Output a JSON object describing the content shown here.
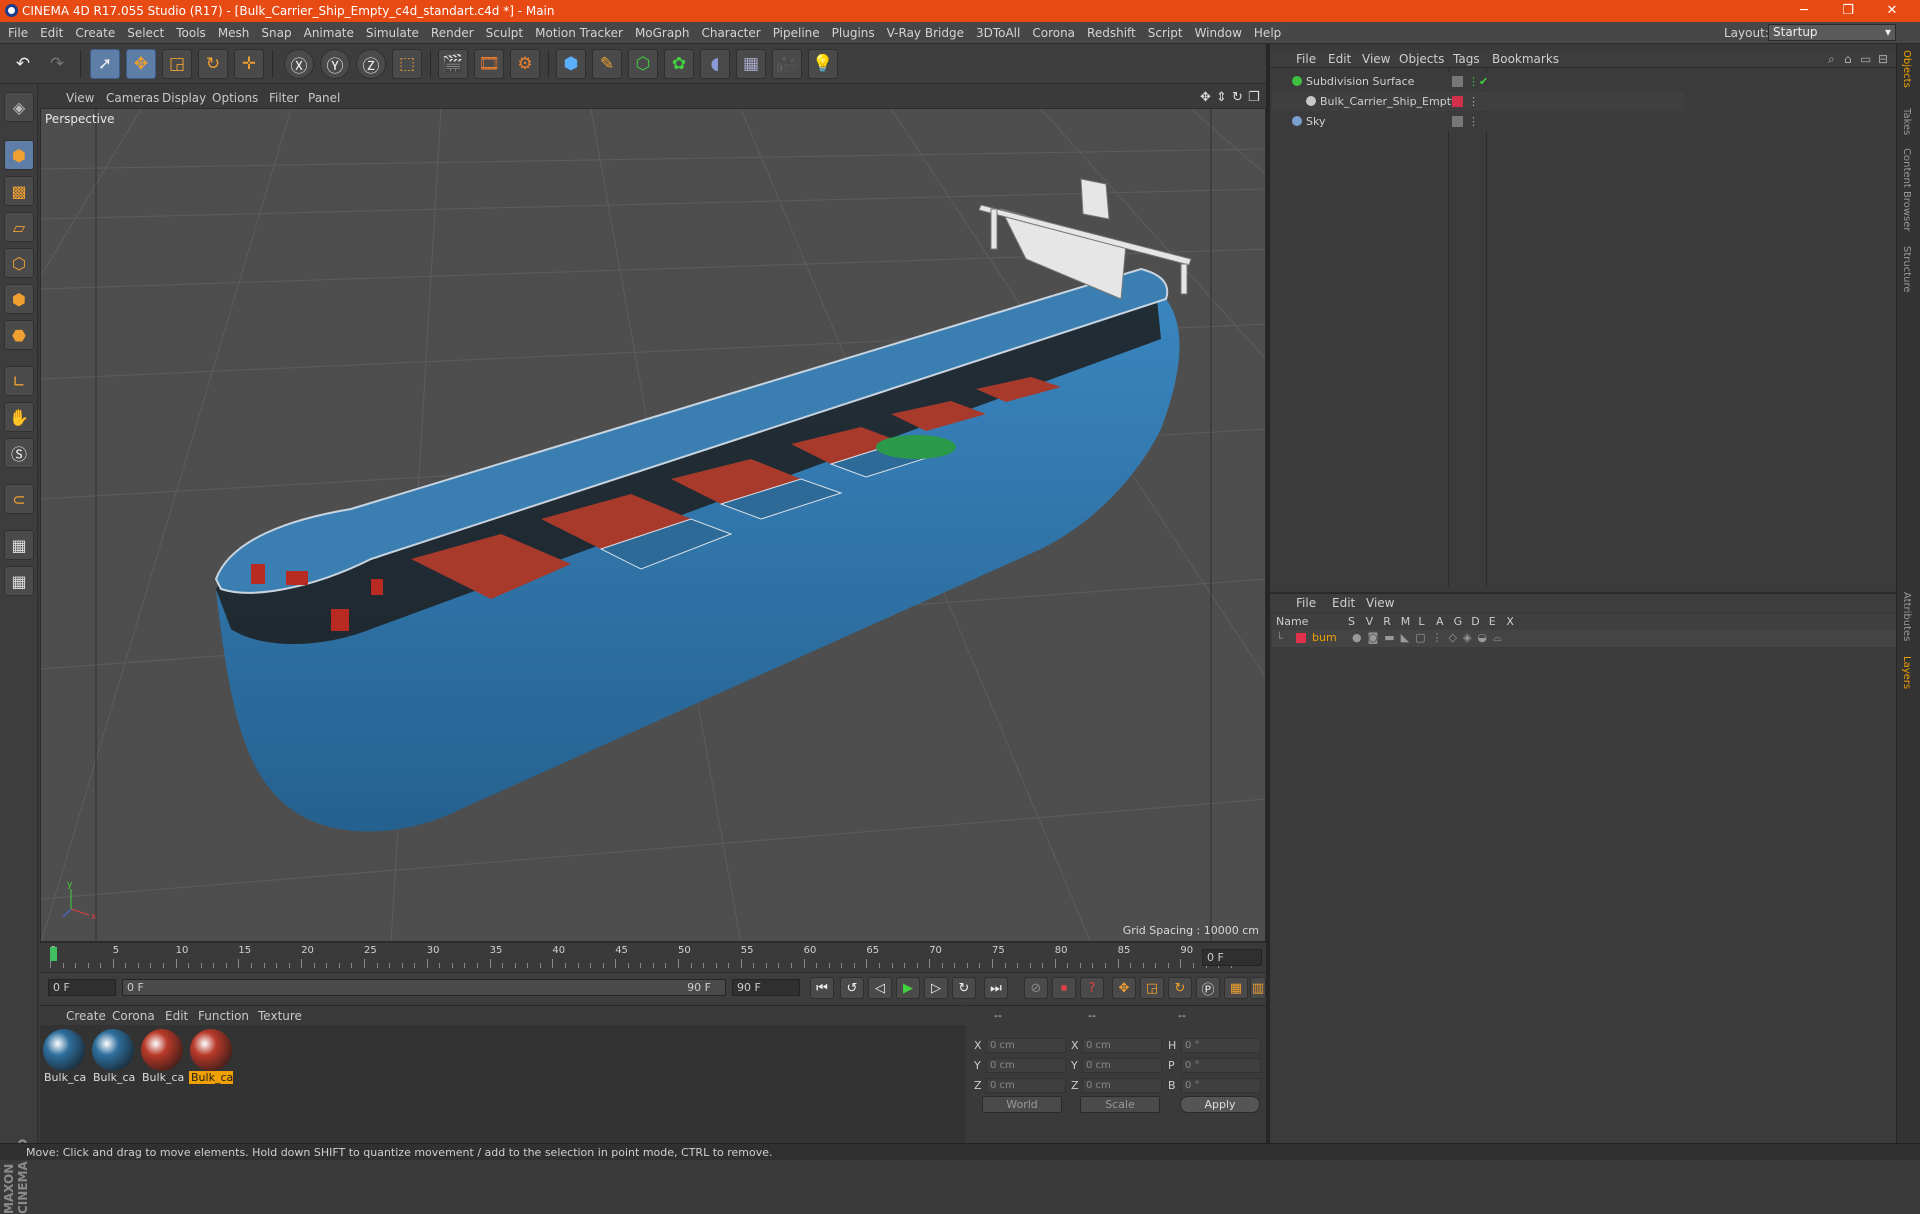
{
  "window": {
    "title": "CINEMA 4D R17.055 Studio (R17) - [Bulk_Carrier_Ship_Empty_c4d_standart.c4d *] - Main",
    "minimize": "─",
    "restore": "❐",
    "close": "✕"
  },
  "menubar": {
    "items": [
      "File",
      "Edit",
      "Create",
      "Select",
      "Tools",
      "Mesh",
      "Snap",
      "Animate",
      "Simulate",
      "Render",
      "Sculpt",
      "Motion Tracker",
      "MoGraph",
      "Character",
      "Pipeline",
      "Plugins",
      "V-Ray Bridge",
      "3DToAll",
      "Corona",
      "Redshift",
      "Script",
      "Window",
      "Help"
    ],
    "layout_label": "Layout:",
    "layout_value": "Startup"
  },
  "viewport": {
    "menu": [
      "View",
      "Cameras",
      "Display",
      "Options",
      "Filter",
      "Panel"
    ],
    "camera_label": "Perspective",
    "grid_spacing": "Grid Spacing : 10000 cm",
    "axis_x": "x",
    "axis_y": "y"
  },
  "timeline": {
    "ticks": [
      "0",
      "5",
      "10",
      "15",
      "20",
      "25",
      "30",
      "35",
      "40",
      "45",
      "50",
      "55",
      "60",
      "65",
      "70",
      "75",
      "80",
      "85",
      "90"
    ],
    "current_frame": "0 F",
    "start_frame": "0 F",
    "range_start": "0 F",
    "range_end": "90 F",
    "end_frame": "90 F"
  },
  "materials": {
    "menu": [
      "Create",
      "Corona",
      "Edit",
      "Function",
      "Texture"
    ],
    "items": [
      {
        "label": "Bulk_car",
        "color": "#2f6f9e",
        "selected": false
      },
      {
        "label": "Bulk_car",
        "color": "#2f6f9e",
        "selected": false
      },
      {
        "label": "Bulk_car",
        "color": "#b83a2a",
        "selected": false
      },
      {
        "label": "Bulk_car",
        "color": "#b83a2a",
        "selected": true
      }
    ]
  },
  "coordinates": {
    "header": [
      "--",
      "--",
      "--"
    ],
    "rows": [
      {
        "a_label": "X",
        "a_val": "0 cm",
        "b_label": "X",
        "b_val": "0 cm",
        "c_label": "H",
        "c_val": "0 °"
      },
      {
        "a_label": "Y",
        "a_val": "0 cm",
        "b_label": "Y",
        "b_val": "0 cm",
        "c_label": "P",
        "c_val": "0 °"
      },
      {
        "a_label": "Z",
        "a_val": "0 cm",
        "b_label": "Z",
        "b_val": "0 cm",
        "c_label": "B",
        "c_val": "0 °"
      }
    ],
    "space": "World",
    "mode": "Scale",
    "apply": "Apply"
  },
  "object_manager": {
    "menu": [
      "File",
      "Edit",
      "View",
      "Objects",
      "Tags",
      "Bookmarks"
    ],
    "objects": [
      {
        "name": "Subdivision Surface",
        "color": "#40c040"
      },
      {
        "name": "Bulk_Carrier_Ship_Empty",
        "color": "#c8c8c8"
      },
      {
        "name": "Sky",
        "color": "#7aa0d0"
      }
    ]
  },
  "layer_manager": {
    "menu": [
      "File",
      "Edit",
      "View"
    ],
    "columns": [
      "Name",
      "S",
      "V",
      "R",
      "M",
      "L",
      "A",
      "G",
      "D",
      "E",
      "X"
    ],
    "layers": [
      {
        "name": "bum",
        "color": "#e0304a"
      }
    ]
  },
  "right_tabs": [
    "Objects",
    "Takes",
    "Content Browser",
    "Structure",
    "Attributes",
    "Layers"
  ],
  "status": "Move: Click and drag to move elements. Hold down SHIFT to quantize movement / add to the selection in point mode, CTRL to remove.",
  "brand": "MAXON CINEMA 4D",
  "colors": {
    "titlebar": "#e84a14",
    "accent": "#f0a000",
    "hull_blue": "#2f6f9e",
    "hold_red": "#b83a2a"
  }
}
